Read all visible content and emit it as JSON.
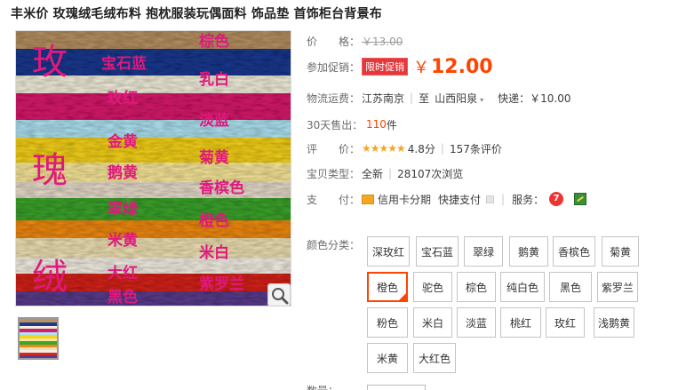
{
  "product": {
    "title": "丰米价 玫瑰绒毛绒布料 抱枕服装玩偶面料 饰品垫 首饰柜台背景布"
  },
  "image_labels": {
    "big": [
      "玫",
      "瑰",
      "绒"
    ],
    "left": [
      "宝石蓝",
      "玫红",
      "金黄",
      "鹅黄",
      "翠绿",
      "米黄",
      "大红",
      "黑色"
    ],
    "right": [
      "棕色",
      "乳白",
      "淡蓝",
      "菊黄",
      "香槟色",
      "橙色",
      "米白",
      "紫罗兰"
    ]
  },
  "info": {
    "price": {
      "label": "价　　格：",
      "value": "￥13.00"
    },
    "promo": {
      "label": "参加促销：",
      "badge": "限时促销",
      "yen": "￥",
      "price": "12.00"
    },
    "shipping": {
      "label": "物流运费：",
      "from": "江苏南京",
      "sep": "|",
      "to_prefix": "至",
      "to": "山西阳泉",
      "dd": "▾",
      "fee_label": "快递：",
      "fee": "￥10.00"
    },
    "sold": {
      "label": "30天售出：",
      "count": "110",
      "unit": "件"
    },
    "rating": {
      "label": "评　　价：",
      "stars": "★★★★★",
      "score": "4.8分",
      "sep": "|",
      "reviews": "157条评价"
    },
    "type": {
      "label": "宝贝类型：",
      "value": "全新",
      "sep": "|",
      "views": "28107次浏览"
    },
    "pay": {
      "label": "支　　付：",
      "option1": "信用卡分期",
      "option2": "快捷支付",
      "service_label": "服务：",
      "service_icon": "7"
    }
  },
  "colors": {
    "label": "颜色分类：",
    "options": [
      "深玫红",
      "宝石蓝",
      "翠绿",
      "鹅黄",
      "香槟色",
      "菊黄",
      "橙色",
      "驼色",
      "棕色",
      "纯白色",
      "黑色",
      "紫罗兰",
      "粉色",
      "米白",
      "淡蓝",
      "桃红",
      "玫红",
      "浅鹅黄",
      "米黄",
      "大红色"
    ],
    "selected": "橙色"
  },
  "quantity": {
    "label": "数量："
  },
  "palette": {
    "accent": "#ff4400",
    "badge": "#e4393c",
    "stars": "#f5a623",
    "label_text": "#e0197d"
  }
}
